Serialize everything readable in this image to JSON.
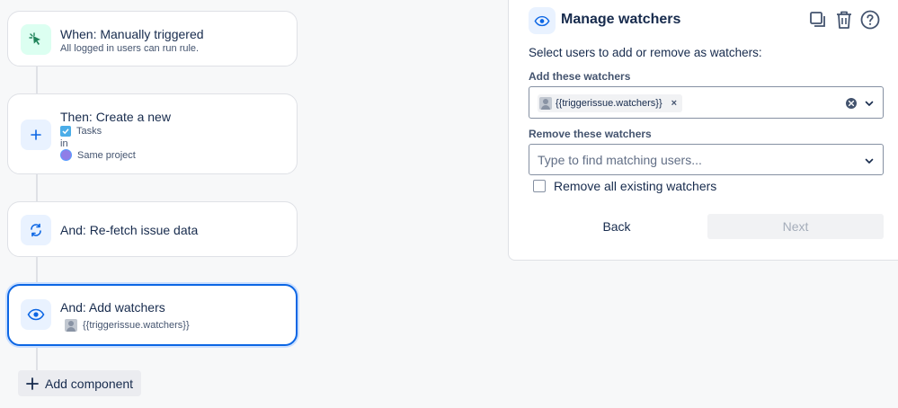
{
  "flow": {
    "trigger": {
      "title": "When: Manually triggered",
      "subtitle": "All logged in users can run rule."
    },
    "create": {
      "title": "Then: Create a new",
      "issue_type": "Tasks",
      "in_label": "in",
      "project": "Same project"
    },
    "refetch": {
      "title": "And: Re-fetch issue data"
    },
    "watchers": {
      "title": "And: Add watchers",
      "value": "{{triggerissue.watchers}}"
    },
    "add_component_label": "Add component"
  },
  "panel": {
    "title": "Manage watchers",
    "instruction": "Select users to add or remove as watchers:",
    "add_label": "Add these watchers",
    "add_chip": "{{triggerissue.watchers}}",
    "remove_label": "Remove these watchers",
    "remove_placeholder": "Type to find matching users...",
    "remove_all_label": "Remove all existing watchers",
    "back_label": "Back",
    "next_label": "Next"
  },
  "colors": {
    "accent": "#0c66e4",
    "trigger_icon_bg": "#dcfff1",
    "trigger_icon": "#1f845a",
    "action_icon_bg": "#e9f2ff"
  }
}
